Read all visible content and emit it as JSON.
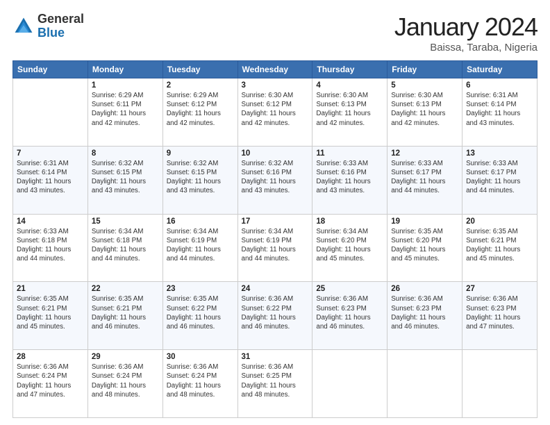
{
  "header": {
    "logo_general": "General",
    "logo_blue": "Blue",
    "title": "January 2024",
    "location": "Baissa, Taraba, Nigeria"
  },
  "weekdays": [
    "Sunday",
    "Monday",
    "Tuesday",
    "Wednesday",
    "Thursday",
    "Friday",
    "Saturday"
  ],
  "weeks": [
    [
      {
        "day": "",
        "info": ""
      },
      {
        "day": "1",
        "info": "Sunrise: 6:29 AM\nSunset: 6:11 PM\nDaylight: 11 hours\nand 42 minutes."
      },
      {
        "day": "2",
        "info": "Sunrise: 6:29 AM\nSunset: 6:12 PM\nDaylight: 11 hours\nand 42 minutes."
      },
      {
        "day": "3",
        "info": "Sunrise: 6:30 AM\nSunset: 6:12 PM\nDaylight: 11 hours\nand 42 minutes."
      },
      {
        "day": "4",
        "info": "Sunrise: 6:30 AM\nSunset: 6:13 PM\nDaylight: 11 hours\nand 42 minutes."
      },
      {
        "day": "5",
        "info": "Sunrise: 6:30 AM\nSunset: 6:13 PM\nDaylight: 11 hours\nand 42 minutes."
      },
      {
        "day": "6",
        "info": "Sunrise: 6:31 AM\nSunset: 6:14 PM\nDaylight: 11 hours\nand 43 minutes."
      }
    ],
    [
      {
        "day": "7",
        "info": "Sunrise: 6:31 AM\nSunset: 6:14 PM\nDaylight: 11 hours\nand 43 minutes."
      },
      {
        "day": "8",
        "info": "Sunrise: 6:32 AM\nSunset: 6:15 PM\nDaylight: 11 hours\nand 43 minutes."
      },
      {
        "day": "9",
        "info": "Sunrise: 6:32 AM\nSunset: 6:15 PM\nDaylight: 11 hours\nand 43 minutes."
      },
      {
        "day": "10",
        "info": "Sunrise: 6:32 AM\nSunset: 6:16 PM\nDaylight: 11 hours\nand 43 minutes."
      },
      {
        "day": "11",
        "info": "Sunrise: 6:33 AM\nSunset: 6:16 PM\nDaylight: 11 hours\nand 43 minutes."
      },
      {
        "day": "12",
        "info": "Sunrise: 6:33 AM\nSunset: 6:17 PM\nDaylight: 11 hours\nand 44 minutes."
      },
      {
        "day": "13",
        "info": "Sunrise: 6:33 AM\nSunset: 6:17 PM\nDaylight: 11 hours\nand 44 minutes."
      }
    ],
    [
      {
        "day": "14",
        "info": "Sunrise: 6:33 AM\nSunset: 6:18 PM\nDaylight: 11 hours\nand 44 minutes."
      },
      {
        "day": "15",
        "info": "Sunrise: 6:34 AM\nSunset: 6:18 PM\nDaylight: 11 hours\nand 44 minutes."
      },
      {
        "day": "16",
        "info": "Sunrise: 6:34 AM\nSunset: 6:19 PM\nDaylight: 11 hours\nand 44 minutes."
      },
      {
        "day": "17",
        "info": "Sunrise: 6:34 AM\nSunset: 6:19 PM\nDaylight: 11 hours\nand 44 minutes."
      },
      {
        "day": "18",
        "info": "Sunrise: 6:34 AM\nSunset: 6:20 PM\nDaylight: 11 hours\nand 45 minutes."
      },
      {
        "day": "19",
        "info": "Sunrise: 6:35 AM\nSunset: 6:20 PM\nDaylight: 11 hours\nand 45 minutes."
      },
      {
        "day": "20",
        "info": "Sunrise: 6:35 AM\nSunset: 6:21 PM\nDaylight: 11 hours\nand 45 minutes."
      }
    ],
    [
      {
        "day": "21",
        "info": "Sunrise: 6:35 AM\nSunset: 6:21 PM\nDaylight: 11 hours\nand 45 minutes."
      },
      {
        "day": "22",
        "info": "Sunrise: 6:35 AM\nSunset: 6:21 PM\nDaylight: 11 hours\nand 46 minutes."
      },
      {
        "day": "23",
        "info": "Sunrise: 6:35 AM\nSunset: 6:22 PM\nDaylight: 11 hours\nand 46 minutes."
      },
      {
        "day": "24",
        "info": "Sunrise: 6:36 AM\nSunset: 6:22 PM\nDaylight: 11 hours\nand 46 minutes."
      },
      {
        "day": "25",
        "info": "Sunrise: 6:36 AM\nSunset: 6:23 PM\nDaylight: 11 hours\nand 46 minutes."
      },
      {
        "day": "26",
        "info": "Sunrise: 6:36 AM\nSunset: 6:23 PM\nDaylight: 11 hours\nand 46 minutes."
      },
      {
        "day": "27",
        "info": "Sunrise: 6:36 AM\nSunset: 6:23 PM\nDaylight: 11 hours\nand 47 minutes."
      }
    ],
    [
      {
        "day": "28",
        "info": "Sunrise: 6:36 AM\nSunset: 6:24 PM\nDaylight: 11 hours\nand 47 minutes."
      },
      {
        "day": "29",
        "info": "Sunrise: 6:36 AM\nSunset: 6:24 PM\nDaylight: 11 hours\nand 48 minutes."
      },
      {
        "day": "30",
        "info": "Sunrise: 6:36 AM\nSunset: 6:24 PM\nDaylight: 11 hours\nand 48 minutes."
      },
      {
        "day": "31",
        "info": "Sunrise: 6:36 AM\nSunset: 6:25 PM\nDaylight: 11 hours\nand 48 minutes."
      },
      {
        "day": "",
        "info": ""
      },
      {
        "day": "",
        "info": ""
      },
      {
        "day": "",
        "info": ""
      }
    ]
  ]
}
